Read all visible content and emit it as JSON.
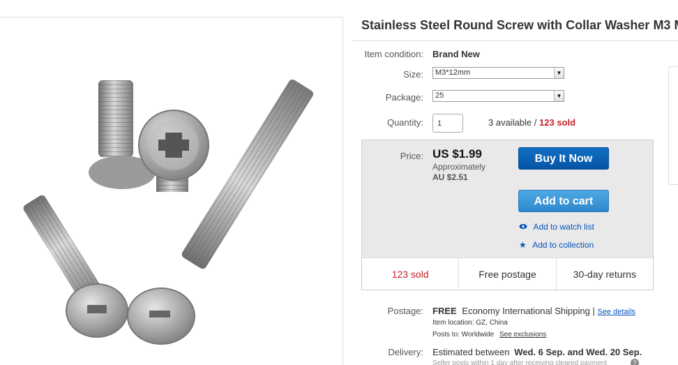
{
  "title": "Stainless Steel Round Screw with Collar Washer M3 M",
  "condition": {
    "label": "Item condition:",
    "value": "Brand New"
  },
  "size": {
    "label": "Size:",
    "value": "M3*12mm"
  },
  "package": {
    "label": "Package:",
    "value": "25"
  },
  "quantity": {
    "label": "Quantity:",
    "value": "1",
    "available": "3 available /",
    "sold": "123 sold"
  },
  "price": {
    "label": "Price:",
    "value": "US $1.99",
    "approx": "Approximately",
    "converted": "AU $2.51",
    "buy_now": "Buy It Now",
    "add_to_cart": "Add to cart",
    "watch": "Add to watch list",
    "collection": "Add to collection",
    "stats": [
      "123 sold",
      "Free postage",
      "30-day returns"
    ]
  },
  "postage": {
    "label": "Postage:",
    "free": "FREE",
    "method": "Economy International Shipping",
    "sep": "|",
    "details_link": "See details",
    "location": "Item location:  GZ, China",
    "posts_to": "Posts to:  Worldwide",
    "exclusions_link": "See exclusions"
  },
  "delivery": {
    "label": "Delivery:",
    "text": "Estimated between",
    "range": "Wed. 6 Sep. and Wed. 20 Sep.",
    "note": "Seller posts within 1 day after",
    "note_link": "receiving cleared payment",
    "help": "?"
  },
  "colors": {
    "buy": "#0654a5",
    "cart": "#3b94d6",
    "sold_red": "#c7202b",
    "link": "#0654ba"
  }
}
